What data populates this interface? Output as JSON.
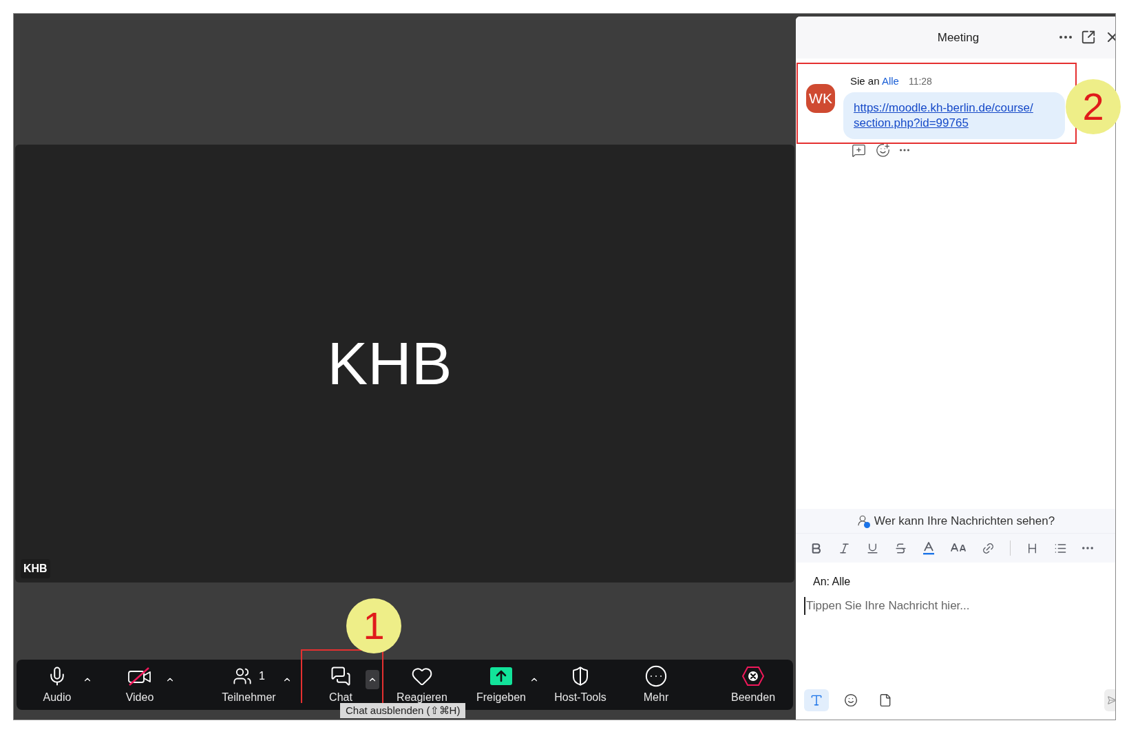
{
  "video_tile": {
    "display_name": "KHB",
    "name_tag": "KHB"
  },
  "toolbar": {
    "items": [
      {
        "kind": "audio",
        "label": "Audio",
        "on": true,
        "menu": true
      },
      {
        "kind": "video",
        "label": "Video",
        "on": false,
        "menu": true
      },
      {
        "kind": "participants",
        "label": "Teilnehmer",
        "count": "1",
        "menu": true
      },
      {
        "kind": "chat",
        "label": "Chat",
        "menu": true
      },
      {
        "kind": "react",
        "label": "Reagieren",
        "menu": false
      },
      {
        "kind": "share",
        "label": "Freigeben",
        "menu": true
      },
      {
        "kind": "host",
        "label": "Host-Tools",
        "menu": false
      },
      {
        "kind": "more",
        "label": "Mehr",
        "menu": false
      },
      {
        "kind": "end",
        "label": "Beenden",
        "menu": false
      }
    ]
  },
  "tooltip": "Chat ausblenden (⇧⌘H)",
  "chat_panel": {
    "title": "Meeting",
    "message": {
      "avatar": "WK",
      "sender": "Sie an",
      "recipient": "Alle",
      "time": "11:28",
      "link": [
        "https://moodle.kh-berlin.de/course/",
        "section.php?id=99765"
      ]
    },
    "privacy_notice": "Wer kann Ihre Nachrichten sehen?",
    "format_tools": [
      {
        "kind": "bold"
      },
      {
        "kind": "italic"
      },
      {
        "kind": "underline"
      },
      {
        "kind": "strikethrough"
      },
      {
        "kind": "font-color"
      },
      {
        "kind": "font-size"
      },
      {
        "kind": "link"
      },
      {
        "kind": "divider"
      },
      {
        "kind": "heading"
      },
      {
        "kind": "list"
      },
      {
        "kind": "more"
      }
    ],
    "recipient_line": "An: Alle",
    "placeholder": "Tippen Sie Ihre Nachricht hier...",
    "bottom_tools": [
      {
        "kind": "text-format",
        "selected": true
      },
      {
        "kind": "emoji",
        "selected": false
      },
      {
        "kind": "file",
        "selected": false
      }
    ]
  },
  "annotations": [
    {
      "label": "1"
    },
    {
      "label": "2"
    }
  ]
}
